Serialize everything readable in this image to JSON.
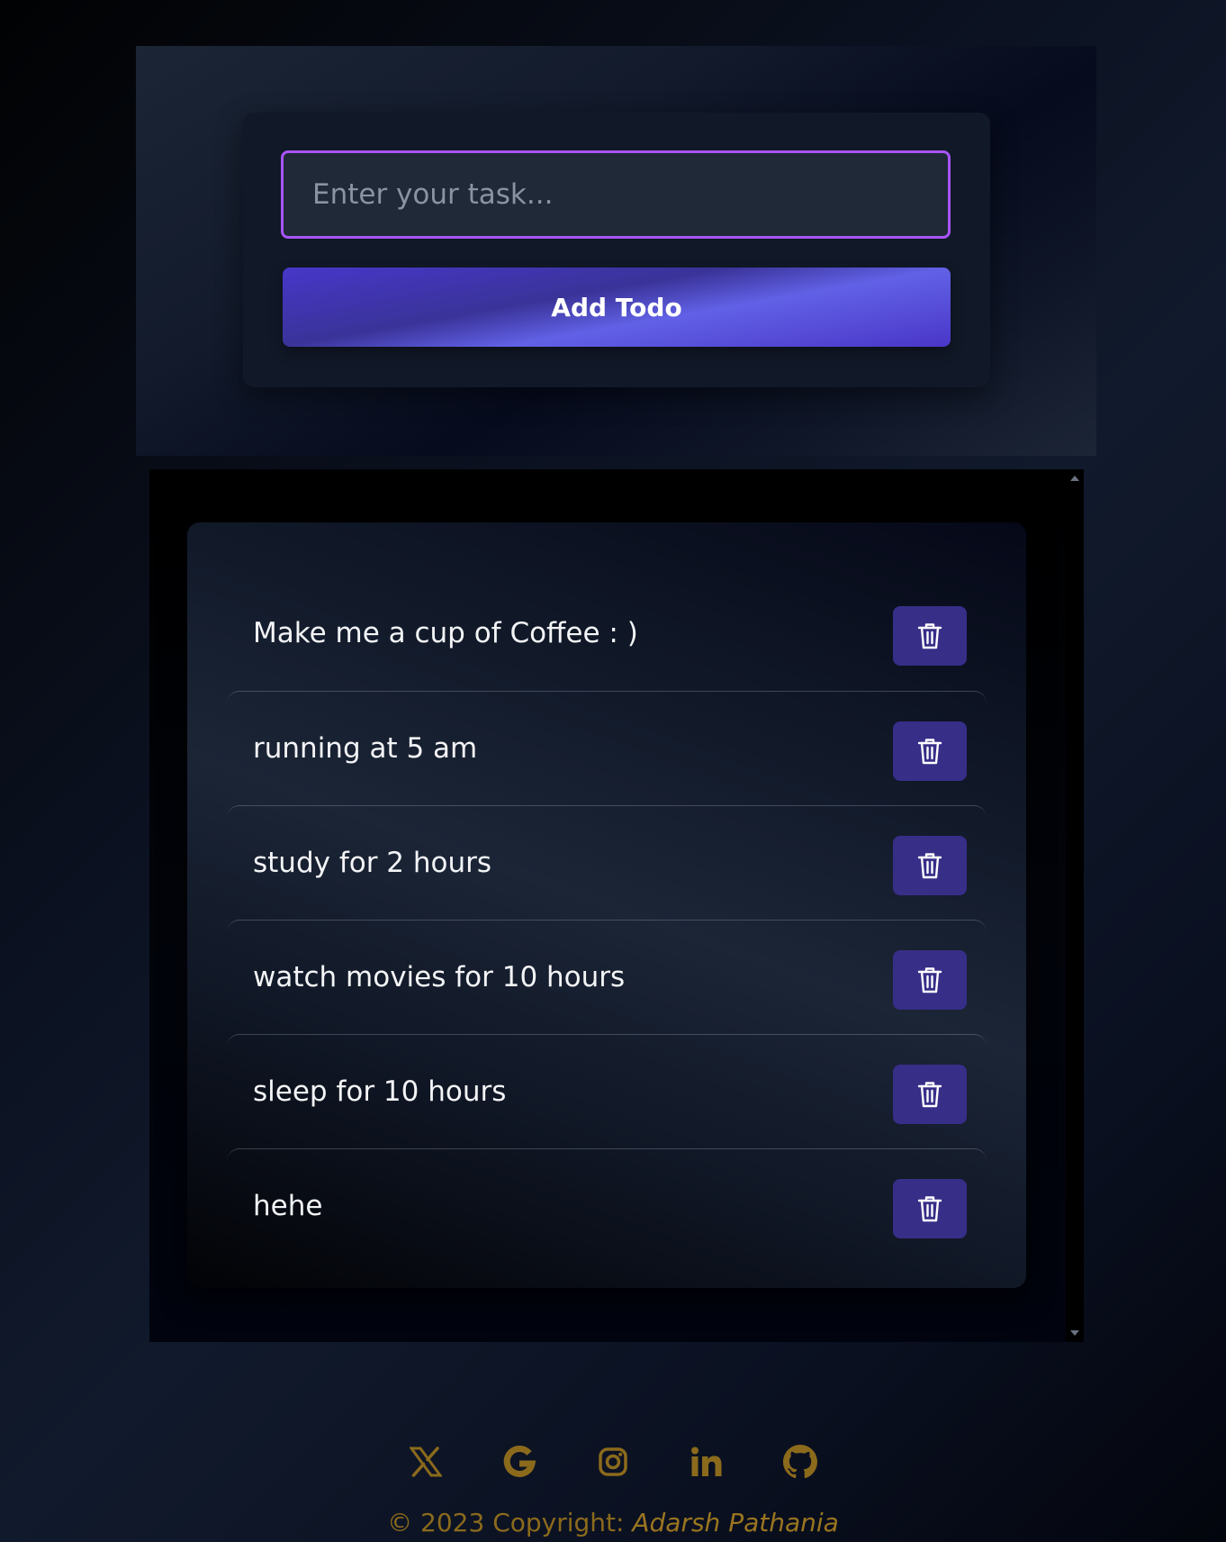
{
  "input_panel": {
    "placeholder": "Enter your task...",
    "add_button_label": "Add Todo"
  },
  "todos": [
    {
      "text": "Make me a cup of Coffee : )"
    },
    {
      "text": "running at 5 am"
    },
    {
      "text": "study for 2 hours"
    },
    {
      "text": "watch movies for 10 hours"
    },
    {
      "text": "sleep for 10 hours"
    },
    {
      "text": "hehe"
    }
  ],
  "footer": {
    "social_icons": [
      "x-icon",
      "google-icon",
      "instagram-icon",
      "linkedin-icon",
      "github-icon"
    ],
    "copyright_prefix": "© 2023 Copyright: ",
    "author": "Adarsh Pathania"
  },
  "colors": {
    "accent_border": "#a855f7",
    "button_indigo": "#4f46e5",
    "delete_button": "#372e88",
    "footer_gold": "#8b6a1c"
  }
}
